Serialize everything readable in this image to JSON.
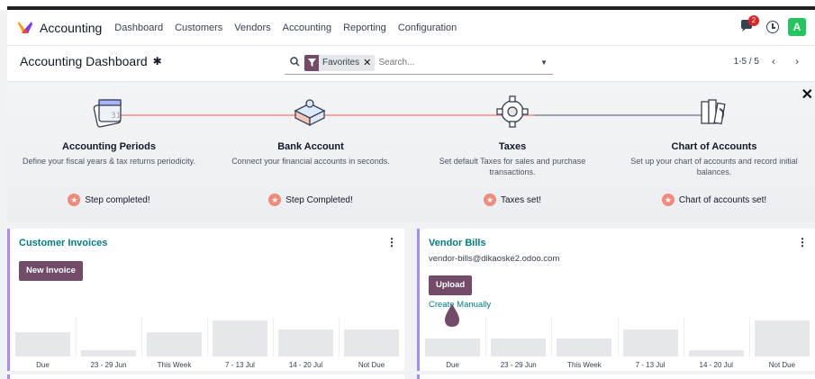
{
  "navbar": {
    "app_name": "Accounting",
    "menu": [
      "Dashboard",
      "Customers",
      "Vendors",
      "Accounting",
      "Reporting",
      "Configuration"
    ],
    "message_count": "2",
    "avatar_letter": "A",
    "accent": "#714b67"
  },
  "control": {
    "title": "Accounting Dashboard",
    "facet_label": "Favorites",
    "search_placeholder": "Search...",
    "pager": "1-5 / 5"
  },
  "onboarding": {
    "steps": [
      {
        "title": "Accounting Periods",
        "desc": "Define your fiscal years & tax returns periodicity.",
        "status": "Step completed!",
        "icon": "calendar-icon"
      },
      {
        "title": "Bank Account",
        "desc": "Connect your financial accounts in seconds.",
        "status": "Step Completed!",
        "icon": "puzzle-icon"
      },
      {
        "title": "Taxes",
        "desc": "Set default Taxes for sales and purchase transactions.",
        "status": "Taxes set!",
        "icon": "gear-icon"
      },
      {
        "title": "Chart of Accounts",
        "desc": "Set up your chart of accounts and record initial balances.",
        "status": "Chart of accounts set!",
        "icon": "books-icon"
      }
    ]
  },
  "cards": [
    {
      "title": "Customer Invoices",
      "button": "New Invoice",
      "columns": [
        "Due",
        "23 - 29 Jun",
        "This Week",
        "7 - 13 Jul",
        "14 - 20 Jul",
        "Not Due"
      ],
      "bar_levels": [
        0.62,
        0.17,
        0.62,
        0.9,
        0.68,
        0.68
      ]
    },
    {
      "title": "Vendor Bills",
      "subtitle": "vendor-bills@dikaoske2.odoo.com",
      "button": "Upload",
      "link": "Create Manually",
      "columns": [
        "Due",
        "23 - 29 Jun",
        "This Week",
        "7 - 13 Jul",
        "14 - 20 Jul",
        "Not Due"
      ],
      "bar_levels": [
        0.45,
        0.45,
        0.45,
        0.68,
        0.17,
        0.9
      ]
    }
  ]
}
